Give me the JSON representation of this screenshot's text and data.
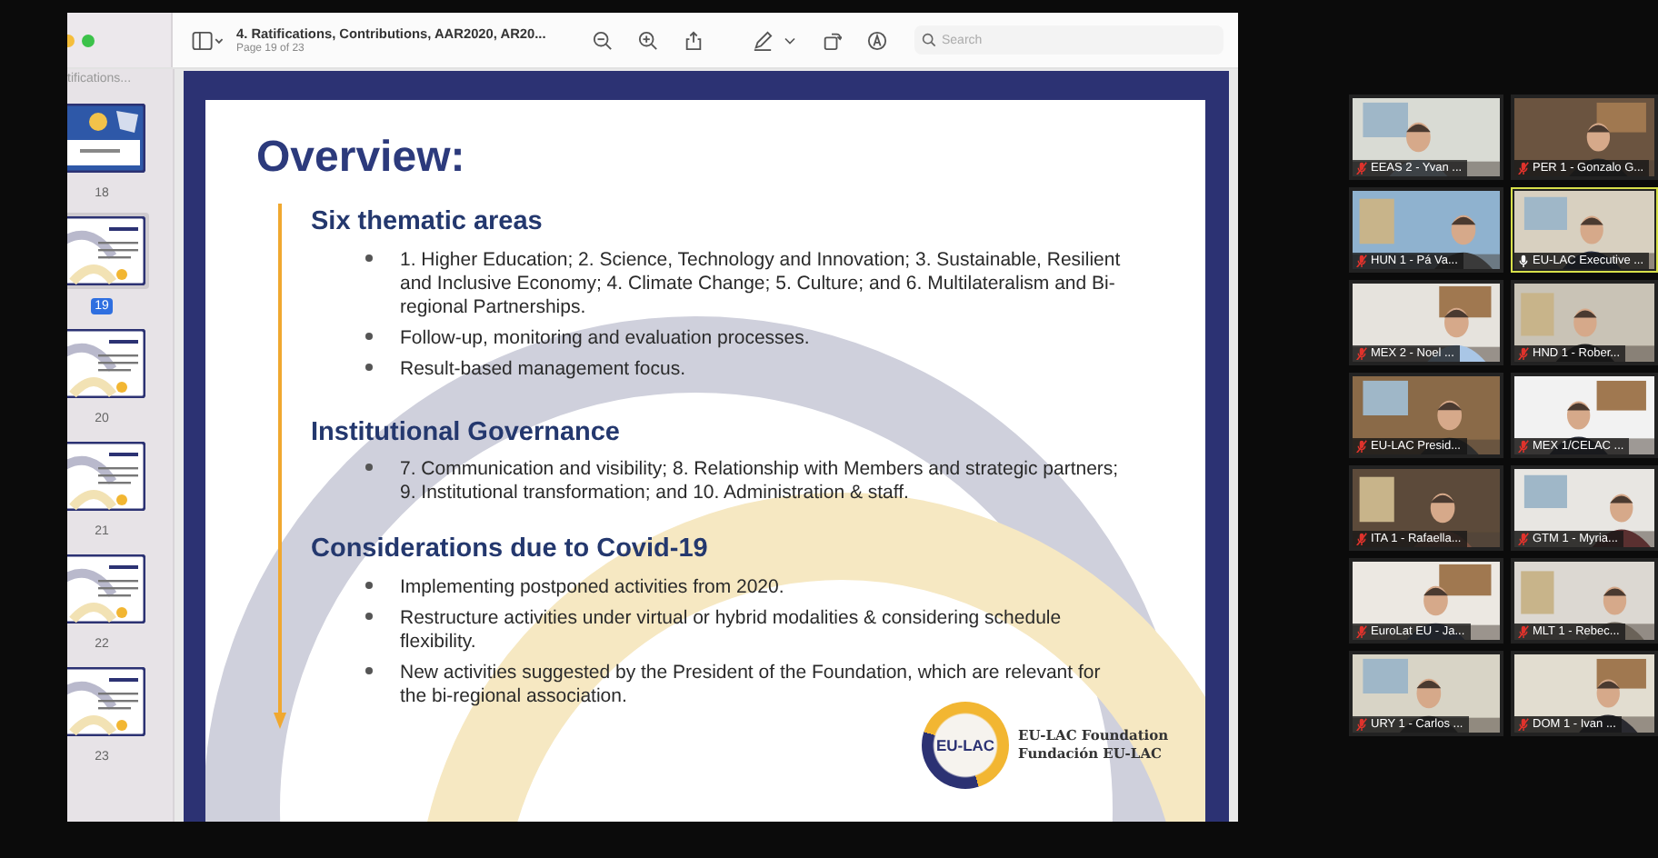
{
  "window": {
    "title": "4. Ratifications, Contributions, AAR2020, AR20...",
    "subtitle": "Page 19 of 23"
  },
  "toolbar": {
    "search": {
      "placeholder": "Search"
    }
  },
  "sidebar": {
    "title": "tifications...",
    "pages": [
      {
        "label": "18",
        "selected": false
      },
      {
        "label": "19",
        "selected": true
      },
      {
        "label": "20",
        "selected": false
      },
      {
        "label": "21",
        "selected": false
      },
      {
        "label": "22",
        "selected": false
      },
      {
        "label": "23",
        "selected": false
      }
    ]
  },
  "slide": {
    "title": "Overview:",
    "sections": [
      {
        "heading": "Six thematic areas",
        "bullets": [
          "1. Higher Education; 2. Science, Technology and Innovation; 3. Sustainable, Resilient and Inclusive Economy; 4. Climate Change; 5. Culture; and 6. Multilateralism and Bi-regional Partnerships.",
          "Follow-up, monitoring and evaluation processes.",
          "Result-based management focus."
        ]
      },
      {
        "heading": "Institutional Governance",
        "bullets": [
          "7. Communication and visibility; 8. Relationship with Members and strategic partners; 9. Institutional transformation; and 10. Administration & staff."
        ]
      },
      {
        "heading": "Considerations due to Covid-19",
        "bullets": [
          "Implementing postponed activities from 2020.",
          "Restructure activities under virtual or hybrid modalities & considering schedule flexibility.",
          "New activities suggested by the President of the Foundation, which are relevant for the bi-regional association."
        ]
      }
    ],
    "logo": {
      "mark": "EU-LAC",
      "lines": [
        "EU-LAC Foundation",
        "Fundación EU-LAC"
      ]
    }
  },
  "participants": [
    {
      "name": "EEAS 2 - Yvan ...",
      "muted": true,
      "speaking": false
    },
    {
      "name": "PER 1 - Gonzalo G...",
      "muted": true,
      "speaking": false
    },
    {
      "name": "HUN 1 - Pá Va...",
      "muted": true,
      "speaking": false
    },
    {
      "name": "EU-LAC Executive ...",
      "muted": false,
      "speaking": true
    },
    {
      "name": "MEX 2 - Noel ...",
      "muted": true,
      "speaking": false
    },
    {
      "name": "HND 1 - Rober...",
      "muted": true,
      "speaking": false
    },
    {
      "name": "EU-LAC Presid...",
      "muted": true,
      "speaking": false
    },
    {
      "name": "MEX 1/CELAC ...",
      "muted": true,
      "speaking": false
    },
    {
      "name": "ITA 1 - Rafaella...",
      "muted": true,
      "speaking": false
    },
    {
      "name": "GTM 1 - Myria...",
      "muted": true,
      "speaking": false
    },
    {
      "name": "EuroLat EU - Ja...",
      "muted": true,
      "speaking": false
    },
    {
      "name": "MLT 1 - Rebec...",
      "muted": true,
      "speaking": false
    },
    {
      "name": "URY 1 - Carlos ...",
      "muted": true,
      "speaking": false
    },
    {
      "name": "DOM 1 - Ivan ...",
      "muted": true,
      "speaking": false
    }
  ]
}
